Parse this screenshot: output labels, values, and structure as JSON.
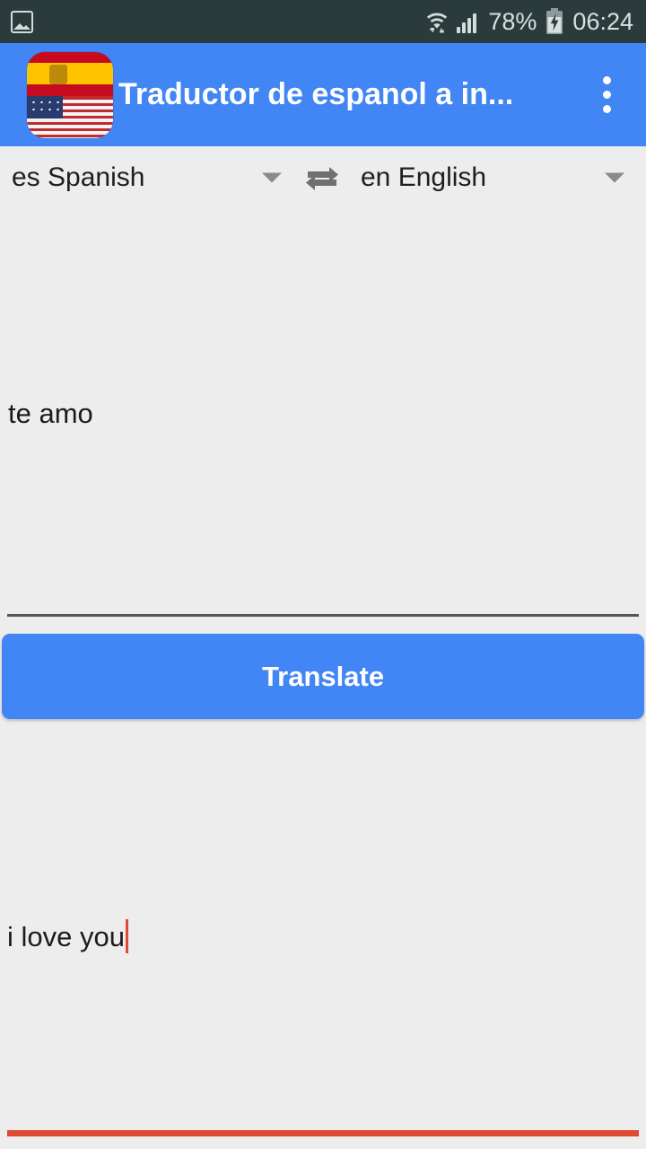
{
  "statusbar": {
    "notification_icon": "gallery-icon",
    "wifi_icon": "wifi-icon",
    "signal_icon": "signal-bars-icon",
    "battery_percent": "78%",
    "battery_icon": "battery-charging-icon",
    "clock": "06:24",
    "background_color": "#2b3b3b",
    "foreground_color": "#d9e0e0"
  },
  "appbar": {
    "app_icon": "spain-usa-flag-icon",
    "title": "Traductor de espanol a in...",
    "overflow_icon": "overflow-menu-icon",
    "background_color": "#4285f4",
    "title_color": "#ffffff"
  },
  "languages": {
    "source": {
      "label": "es Spanish",
      "code": "es",
      "name": "Spanish",
      "caret_icon": "chevron-down-icon"
    },
    "swap_icon": "swap-horizontal-icon",
    "target": {
      "label": "en English",
      "code": "en",
      "name": "English",
      "caret_icon": "chevron-down-icon"
    }
  },
  "source_field": {
    "value": "te amo",
    "placeholder": "",
    "underline_color": "#555555"
  },
  "translate_button": {
    "label": "Translate",
    "color": "#4285f4",
    "text_color": "#ffffff"
  },
  "result_field": {
    "value": "i love you",
    "placeholder": "",
    "focused": "true",
    "underline_color": "#e04a33",
    "cursor_color": "#e04a33"
  },
  "page": {
    "background_color": "#ededed"
  }
}
